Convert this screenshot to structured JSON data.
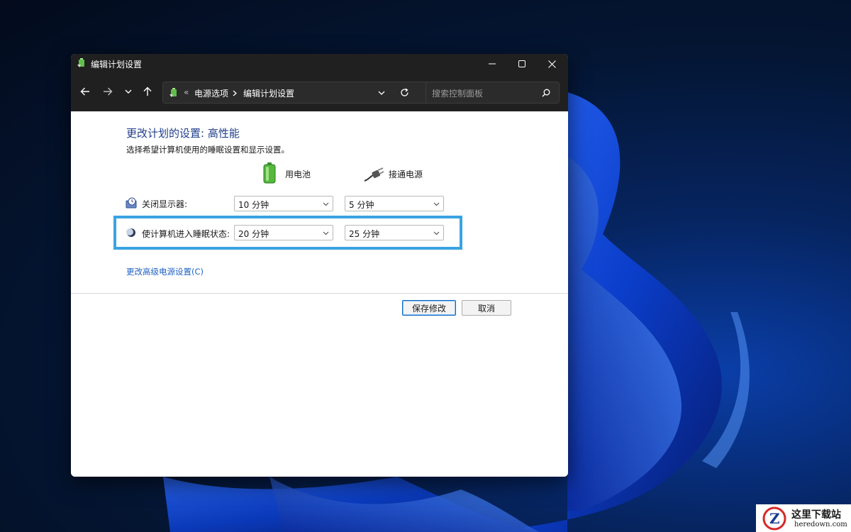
{
  "window": {
    "title": "编辑计划设置"
  },
  "nav": {
    "breadcrumb_prefix": "«",
    "breadcrumb": [
      "电源选项",
      "编辑计划设置"
    ],
    "search_placeholder": "搜索控制面板"
  },
  "content": {
    "heading": "更改计划的设置: 高性能",
    "subtitle": "选择希望计算机使用的睡眠设置和显示设置。",
    "columns": {
      "battery": "用电池",
      "plugged": "接通电源"
    },
    "rows": [
      {
        "label": "关闭显示器:",
        "battery_value": "10 分钟",
        "plugged_value": "5 分钟"
      },
      {
        "label": "使计算机进入睡眠状态:",
        "battery_value": "20 分钟",
        "plugged_value": "25 分钟"
      }
    ],
    "advanced_link": "更改高级电源设置(C)",
    "save_label": "保存修改",
    "cancel_label": "取消"
  },
  "watermark": {
    "name": "这里下载站",
    "url": "heredown.com"
  },
  "colors": {
    "highlight": "#3aa3e2",
    "heading": "#1f3e8a",
    "link": "#1f62c4",
    "titlebar": "#202020"
  }
}
